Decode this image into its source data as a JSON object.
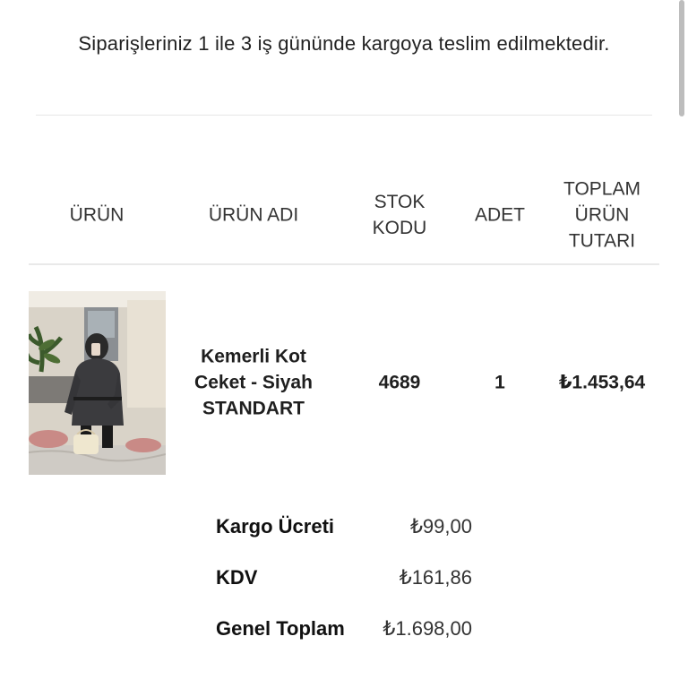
{
  "notice": "Siparişleriniz 1 ile 3 iş gününde kargoya teslim edilmektedir.",
  "table": {
    "headers": {
      "product": "ÜRÜN",
      "product_name": "ÜRÜN ADI",
      "stock_code_1": "STOK",
      "stock_code_2": "KODU",
      "quantity": "ADET",
      "total_1": "TOPLAM",
      "total_2": "ÜRÜN",
      "total_3": "TUTARI"
    },
    "rows": [
      {
        "image": "product-photo-denim-jacket",
        "name_line1": "Kemerli Kot",
        "name_line2": "Ceket - Siyah",
        "name_line3": "STANDART",
        "stock_code": "4689",
        "quantity": "1",
        "total": "₺1.453,64"
      }
    ]
  },
  "summary": {
    "shipping_label": "Kargo Ücreti",
    "shipping_value": "₺99,00",
    "vat_label": "KDV",
    "vat_value": "₺161,86",
    "grand_total_label": "Genel Toplam",
    "grand_total_value": "₺1.698,00"
  },
  "colors": {
    "text": "#1a1a1a",
    "divider": "#e6e6e6",
    "scrollbar": "#bdbdbd"
  }
}
